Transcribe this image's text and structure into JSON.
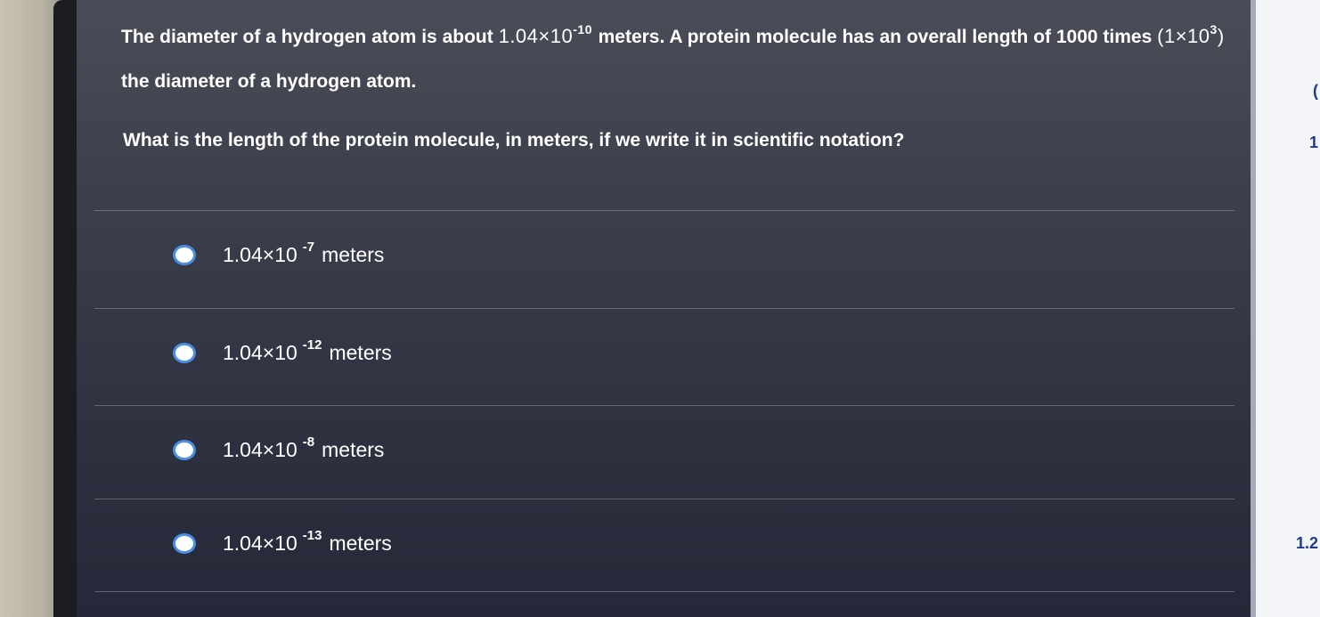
{
  "question": {
    "intro": "The diameter of a hydrogen atom is about",
    "diameter_mantissa": "1.04",
    "times": "×",
    "diameter_base": "10",
    "diameter_exponent": "-10",
    "after_diameter": "meters. A protein molecule has an overall length of 1000 times",
    "factor_mantissa": "1",
    "factor_base": "10",
    "factor_exponent": "3",
    "closing": "the diameter of a hydrogen atom.",
    "prompt": "What is the length of the protein molecule, in meters, if we write it in scientific notation?"
  },
  "options": [
    {
      "mantissa": "1.04",
      "base": "10",
      "exponent": "-7",
      "unit": "meters"
    },
    {
      "mantissa": "1.04",
      "base": "10",
      "exponent": "-12",
      "unit": "meters"
    },
    {
      "mantissa": "1.04",
      "base": "10",
      "exponent": "-8",
      "unit": "meters"
    },
    {
      "mantissa": "1.04",
      "base": "10",
      "exponent": "-13",
      "unit": "meters"
    }
  ],
  "right_panel": {
    "marker_top": "(",
    "marker_middle": "1",
    "marker_bottom": "1.2"
  },
  "colors": {
    "radio_border": "#4a90e2",
    "screen": "#3b3e4a",
    "right_panel": "#f3f4f7"
  }
}
